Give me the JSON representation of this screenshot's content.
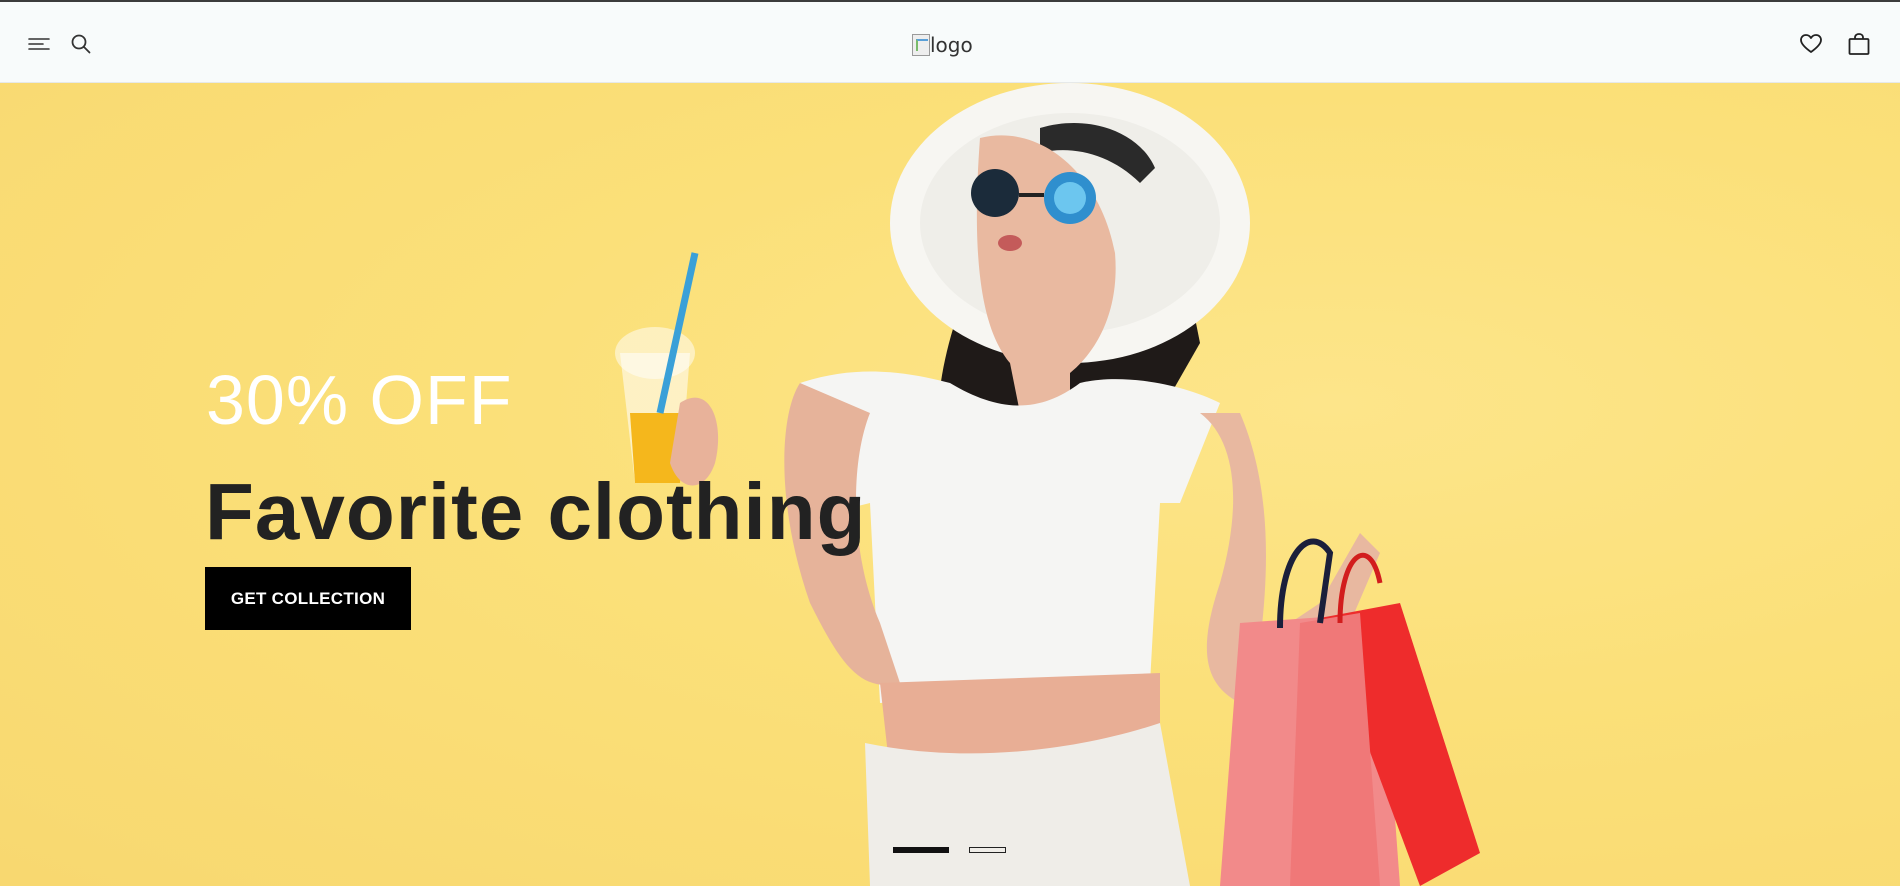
{
  "header": {
    "menu_icon": "menu-icon",
    "search_icon": "search-icon",
    "logo_alt": "logo",
    "wishlist_icon": "heart-icon",
    "cart_icon": "shopping-bag-icon"
  },
  "hero": {
    "promo": "30% OFF",
    "headline": "Favorite clothing",
    "cta_label": "GET COLLECTION",
    "slides": {
      "count": 2,
      "active_index": 0
    },
    "background_color": "#fbe079"
  },
  "colors": {
    "header_bg": "#f8fbfb",
    "cta_bg": "#000000",
    "headline": "#222222",
    "promo": "#ffffff"
  }
}
